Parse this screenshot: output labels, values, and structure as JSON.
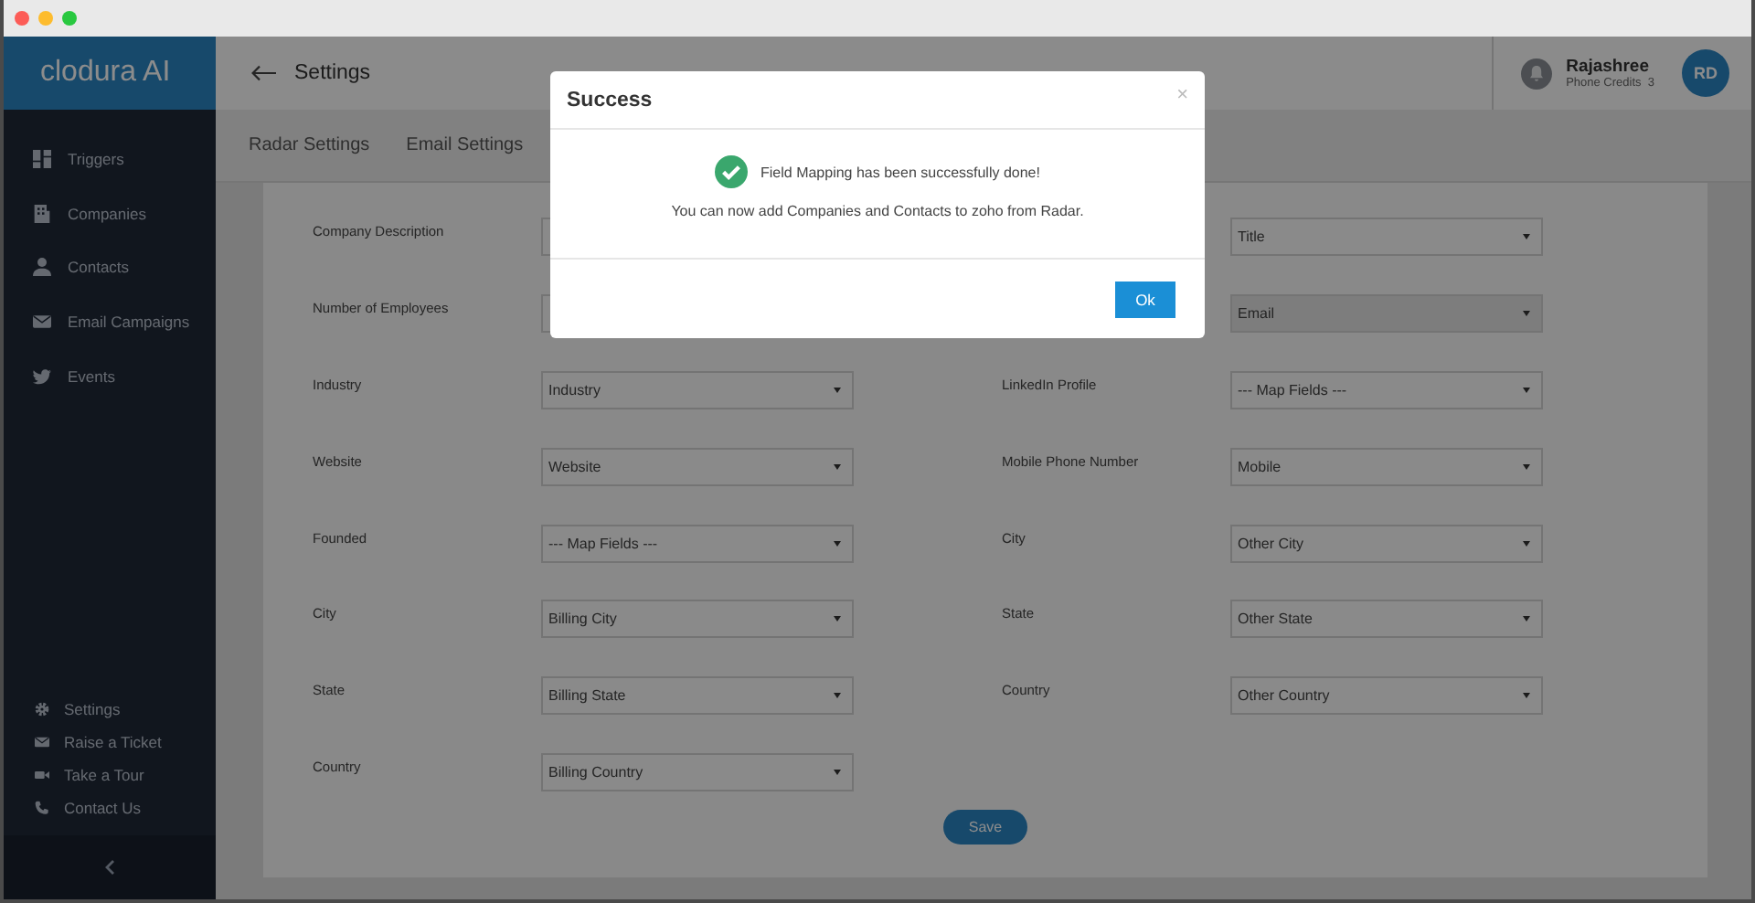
{
  "sidebar": {
    "logo": "clodura AI",
    "nav": [
      {
        "label": "Triggers"
      },
      {
        "label": "Companies"
      },
      {
        "label": "Contacts"
      },
      {
        "label": "Email Campaigns"
      },
      {
        "label": "Events"
      }
    ],
    "footer": [
      {
        "label": "Settings"
      },
      {
        "label": "Raise a Ticket"
      },
      {
        "label": "Take a Tour"
      },
      {
        "label": "Contact Us"
      }
    ]
  },
  "header": {
    "title": "Settings",
    "user": {
      "name": "Rajashree",
      "credits": "Phone Credits  3",
      "initials": "RD"
    }
  },
  "tabs": [
    {
      "label": "Radar Settings"
    },
    {
      "label": "Email Settings"
    }
  ],
  "form": {
    "left": [
      {
        "label": "Company Description"
      },
      {
        "label": "Number of Employees"
      },
      {
        "label": "Industry",
        "value": "Industry"
      },
      {
        "label": "Website",
        "value": "Website"
      },
      {
        "label": "Founded",
        "value": "--- Map Fields ---"
      },
      {
        "label": "City",
        "value": "Billing City"
      },
      {
        "label": "State",
        "value": "Billing State"
      },
      {
        "label": "Country",
        "value": "Billing Country"
      }
    ],
    "right": [
      {
        "value": "Title",
        "disabled": false
      },
      {
        "value": "Email",
        "disabled": true
      },
      {
        "label": "LinkedIn Profile",
        "value": "--- Map Fields ---",
        "disabled": false
      },
      {
        "label": "Mobile Phone Number",
        "value": "Mobile",
        "disabled": false
      },
      {
        "label": "City",
        "value": "Other City",
        "disabled": false
      },
      {
        "label": "State",
        "value": "Other State",
        "disabled": false
      },
      {
        "label": "Country",
        "value": "Other Country",
        "disabled": false
      }
    ],
    "save": "Save"
  },
  "modal": {
    "title": "Success",
    "close": "×",
    "message": "Field Mapping has been successfully done!",
    "detail": "You can now add Companies and Contacts to zoho from Radar.",
    "button": "Ok"
  }
}
